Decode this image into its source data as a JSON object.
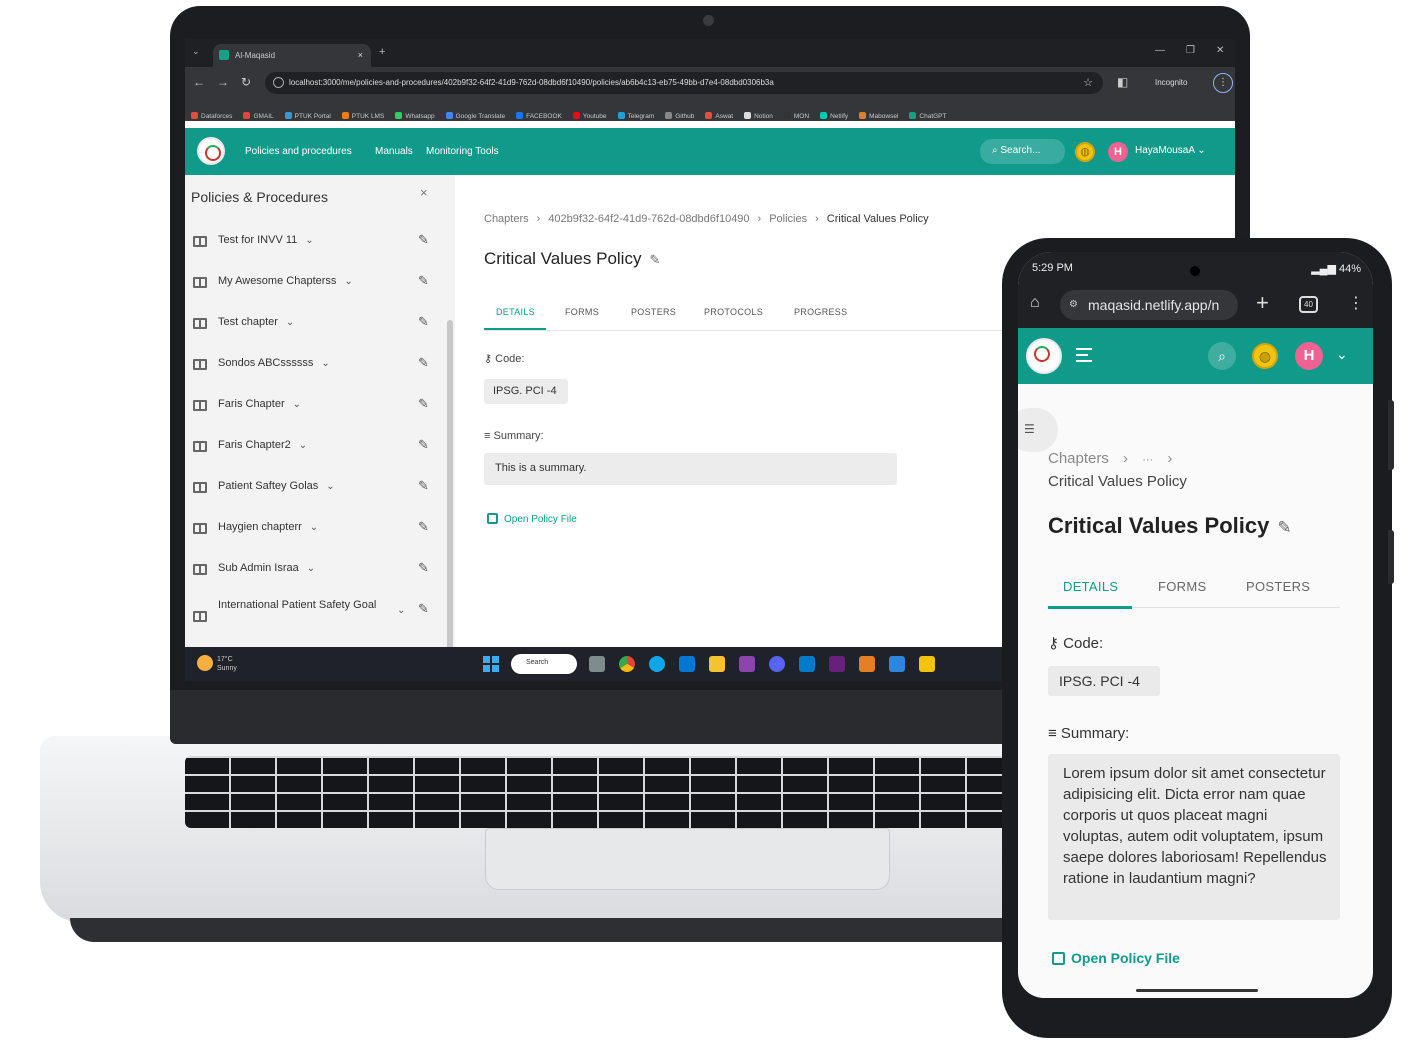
{
  "colors": {
    "brand": "#0f9a8a",
    "avatar": "#f06292",
    "globe": "#f1c40f"
  },
  "laptop": {
    "browser": {
      "tab_title": "Al-Maqasid",
      "tab_close": "×",
      "tab_new": "+",
      "url": "localhost:3000/me/policies-and-procedures/402b9f32-64f2-41d9-762d-08dbd6f10490/policies/ab6b4c13-eb75-49bb-d7e4-08dbd0306b3a",
      "incognito_label": "Incognito",
      "bookmarks": [
        "Dataforces",
        "GMAIL",
        "PTUK Portal",
        "PTUK LMS",
        "Whatsapp",
        "Google Translate",
        "FACEBOOK",
        "Youtube",
        "Telegram",
        "Github",
        "Aswat",
        "Notion",
        "MON",
        "Netlify",
        "Mabowsel",
        "ChatGPT"
      ]
    },
    "header": {
      "nav": [
        "Policies and procedures",
        "Manuals",
        "Monitoring Tools"
      ],
      "search_placeholder": "Search...",
      "avatar_initial": "H",
      "user_name": "HayaMousaA"
    },
    "sidebar": {
      "title": "Policies & Procedures",
      "close": "×",
      "items": [
        {
          "label": "Test for INVV 11"
        },
        {
          "label": "My Awesome Chapterss"
        },
        {
          "label": "Test chapter"
        },
        {
          "label": "Sondos ABCssssss"
        },
        {
          "label": "Faris Chapter"
        },
        {
          "label": "Faris Chapter2"
        },
        {
          "label": "Patient Saftey Golas"
        },
        {
          "label": "Haygien chapterr"
        },
        {
          "label": "Sub Admin Israa"
        },
        {
          "label": "International Patient Safety Goal"
        }
      ]
    },
    "main": {
      "breadcrumbs": [
        "Chapters",
        "402b9f32-64f2-41d9-762d-08dbd6f10490",
        "Policies",
        "Critical Values Policy"
      ],
      "title": "Critical Values Policy",
      "tabs": [
        "DETAILS",
        "FORMS",
        "POSTERS",
        "PROTOCOLS",
        "PROGRESS"
      ],
      "code_label": "Code:",
      "code_value": "IPSG. PCI -4",
      "summary_label": "Summary:",
      "summary_value": "This is a summary.",
      "open_file": "Open Policy File"
    },
    "taskbar": {
      "weather": "17°C",
      "weather_sub": "Sunny",
      "search": "Search"
    }
  },
  "phone": {
    "status": {
      "time": "5:29 PM",
      "battery": "44%"
    },
    "chrome": {
      "url": "maqasid.netlify.app/n",
      "tab_count": "40"
    },
    "header": {
      "avatar_initial": "H"
    },
    "breadcrumbs": {
      "root": "Chapters",
      "ellipsis": "···",
      "current": "Critical Values Policy"
    },
    "title": "Critical Values Policy",
    "tabs": [
      "DETAILS",
      "FORMS",
      "POSTERS"
    ],
    "code_label": "Code:",
    "code_value": "IPSG. PCI -4",
    "summary_label": "Summary:",
    "summary_value": "Lorem ipsum dolor sit amet consectetur adipisicing elit. Dicta error nam quae corporis ut quos placeat magni voluptas, autem odit voluptatem, ipsum saepe dolores laboriosam! Repellendus ratione in laudantium magni?",
    "open_file": "Open Policy File"
  }
}
